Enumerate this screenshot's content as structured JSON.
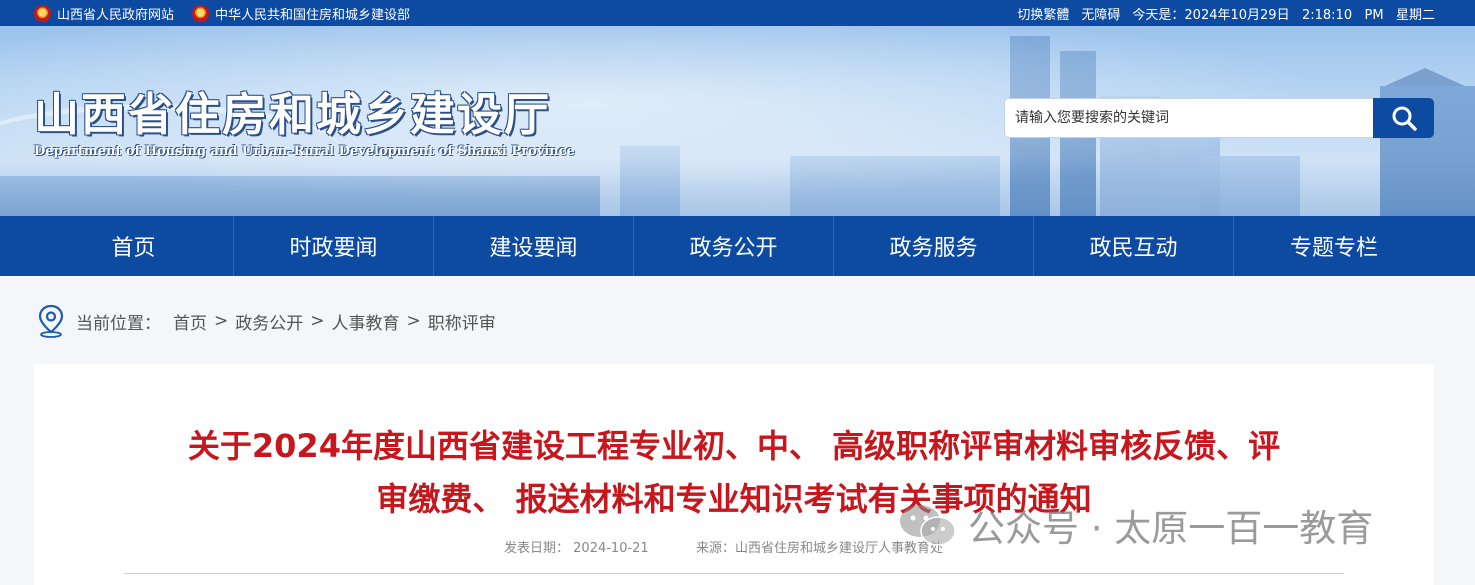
{
  "topbar": {
    "links": [
      "山西省人民政府网站",
      "中华人民共和国住房和城乡建设部"
    ],
    "switch_label": "切换繁體",
    "accessibility_label": "无障碍",
    "today_label": "今天是：",
    "date": "2024年10月29日",
    "time": "2:18:10",
    "ampm": "PM",
    "weekday": "星期二"
  },
  "header": {
    "title": "山西省住房和城乡建设厅",
    "subtitle": "Department of Housing and Urban–Rural Development of Shanxi Province"
  },
  "search": {
    "placeholder": "请输入您要搜索的关键词",
    "icon": "search-icon"
  },
  "nav": {
    "items": [
      "首页",
      "时政要闻",
      "建设要闻",
      "政务公开",
      "政务服务",
      "政民互动",
      "专题专栏"
    ]
  },
  "breadcrumb": {
    "label": "当前位置：",
    "items": [
      "首页",
      "政务公开",
      "人事教育",
      "职称评审"
    ],
    "separator": ">"
  },
  "article": {
    "title_line1": "关于2024年度山西省建设工程专业初、中、 高级职称评审材料审核反馈、评",
    "title_line2": "审缴费、 报送材料和专业知识考试有关事项的通知",
    "date_label": "发表日期：",
    "date": "2024-10-21",
    "source_label": "来源：",
    "source": "山西省住房和城乡建设厅人事教育处"
  },
  "watermark": {
    "text": "公众号 · 太原一百一教育"
  },
  "colors": {
    "primary": "#0d4aa1",
    "title_red": "#c8161d",
    "card_bg": "#ffffff",
    "page_bg": "#f4f6f9"
  }
}
